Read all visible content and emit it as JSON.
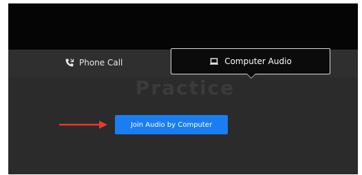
{
  "tabs": {
    "phone_label": "Phone Call",
    "computer_label": "Computer Audio",
    "phone_icon": "phone-icon",
    "computer_icon": "laptop-icon"
  },
  "content": {
    "watermark": "Practice",
    "join_button_label": "Join Audio by Computer"
  },
  "annotation": {
    "arrow_icon": "red-arrow-icon",
    "arrow_color": "#e8382c"
  },
  "colors": {
    "accent": "#1a7ef2",
    "background": "#2b2b2b",
    "top_bar": "#050505"
  }
}
